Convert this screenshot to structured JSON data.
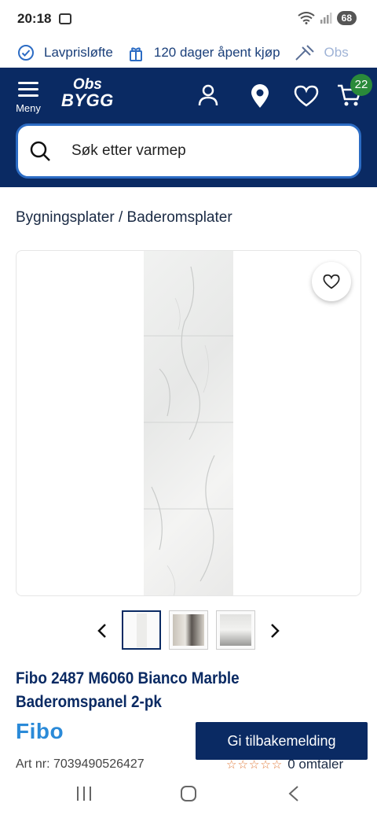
{
  "status": {
    "time": "20:18",
    "battery": "68"
  },
  "usp": [
    {
      "label": "Lavprisløfte",
      "icon": "check-circle-icon"
    },
    {
      "label": "120 dager åpent kjøp",
      "icon": "gift-icon"
    },
    {
      "label": "Obs",
      "icon": "tools-icon"
    }
  ],
  "header": {
    "menu_label": "Meny",
    "logo_line1": "Obs",
    "logo_line2": "BYGG",
    "cart_count": "22"
  },
  "search": {
    "placeholder": "Søk etter varmep"
  },
  "breadcrumb": "Bygningsplater / Baderomsplater",
  "product": {
    "title": "Fibo 2487 M6060 Bianco Marble Baderomspanel 2-pk",
    "brand": "Fibo",
    "art_nr": "Art nr: 7039490526427",
    "rating_text": "0 omtaler",
    "stars": "☆☆☆☆☆"
  },
  "feedback_button": "Gi tilbakemelding",
  "colors": {
    "navy": "#0a2a63",
    "accent_blue": "#2c6cc4",
    "cart_badge": "#2a8a3a",
    "brand_blue": "#2a8ad8"
  }
}
